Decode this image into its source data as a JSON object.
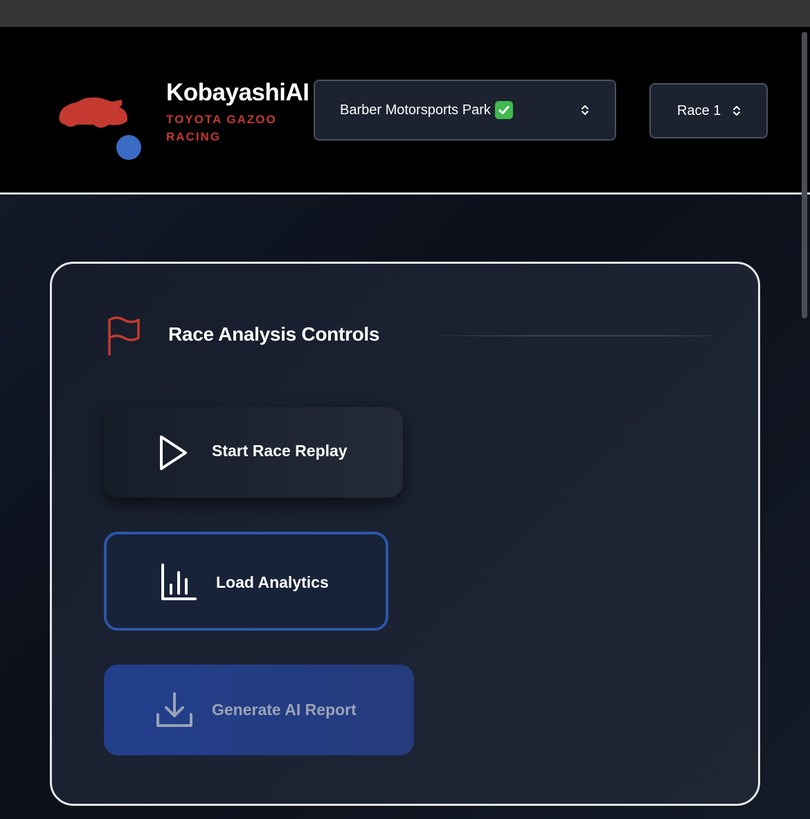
{
  "brand": {
    "title": "KobayashiAI",
    "subtitle": "TOYOTA GAZOO RACING",
    "colors": {
      "accent_red": "#c43a30",
      "accent_blue": "#3a6cc4"
    }
  },
  "header": {
    "track_select": {
      "value": "Barber Motorsports Park",
      "status_icon": "check-mark-icon"
    },
    "race_select": {
      "value": "Race 1"
    }
  },
  "panel": {
    "title": "Race Analysis Controls",
    "icon": "flag-icon",
    "buttons": [
      {
        "label": "Start Race Replay",
        "icon": "play-icon"
      },
      {
        "label": "Load Analytics",
        "icon": "bar-chart-icon"
      },
      {
        "label": "Generate AI Report",
        "icon": "download-icon"
      }
    ]
  }
}
